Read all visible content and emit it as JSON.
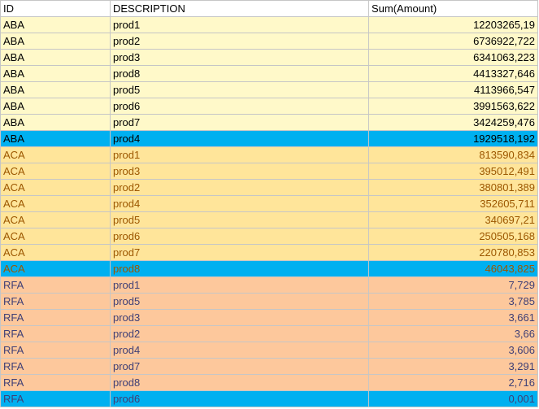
{
  "headers": {
    "id": "ID",
    "description": "DESCRIPTION",
    "amount": "Sum(Amount)"
  },
  "colors": {
    "aba_fill": "#fff9c9",
    "aca_fill": "#ffe59a",
    "rfa_fill": "#fdc89c",
    "selected_fill": "#00b0f0",
    "aca_text": "#9c5700",
    "rfa_text": "#3f3f76"
  },
  "rows": [
    {
      "id": "ABA",
      "description": "prod1",
      "amount": "12203265,19"
    },
    {
      "id": "ABA",
      "description": "prod2",
      "amount": "6736922,722"
    },
    {
      "id": "ABA",
      "description": "prod3",
      "amount": "6341063,223"
    },
    {
      "id": "ABA",
      "description": "prod8",
      "amount": "4413327,646"
    },
    {
      "id": "ABA",
      "description": "prod5",
      "amount": "4113966,547"
    },
    {
      "id": "ABA",
      "description": "prod6",
      "amount": "3991563,622"
    },
    {
      "id": "ABA",
      "description": "prod7",
      "amount": "3424259,476"
    },
    {
      "id": "ABA",
      "description": "prod4",
      "amount": "1929518,192"
    },
    {
      "id": "ACA",
      "description": "prod1",
      "amount": "813590,834"
    },
    {
      "id": "ACA",
      "description": "prod3",
      "amount": "395012,491"
    },
    {
      "id": "ACA",
      "description": "prod2",
      "amount": "380801,389"
    },
    {
      "id": "ACA",
      "description": "prod4",
      "amount": "352605,711"
    },
    {
      "id": "ACA",
      "description": "prod5",
      "amount": "340697,21"
    },
    {
      "id": "ACA",
      "description": "prod6",
      "amount": "250505,168"
    },
    {
      "id": "ACA",
      "description": "prod7",
      "amount": "220780,853"
    },
    {
      "id": "ACA",
      "description": "prod8",
      "amount": "46043,825"
    },
    {
      "id": "RFA",
      "description": "prod1",
      "amount": "7,729"
    },
    {
      "id": "RFA",
      "description": "prod5",
      "amount": "3,785"
    },
    {
      "id": "RFA",
      "description": "prod3",
      "amount": "3,661"
    },
    {
      "id": "RFA",
      "description": "prod2",
      "amount": "3,66"
    },
    {
      "id": "RFA",
      "description": "prod4",
      "amount": "3,606"
    },
    {
      "id": "RFA",
      "description": "prod7",
      "amount": "3,291"
    },
    {
      "id": "RFA",
      "description": "prod8",
      "amount": "2,716"
    },
    {
      "id": "RFA",
      "description": "prod6",
      "amount": "0,001"
    }
  ]
}
